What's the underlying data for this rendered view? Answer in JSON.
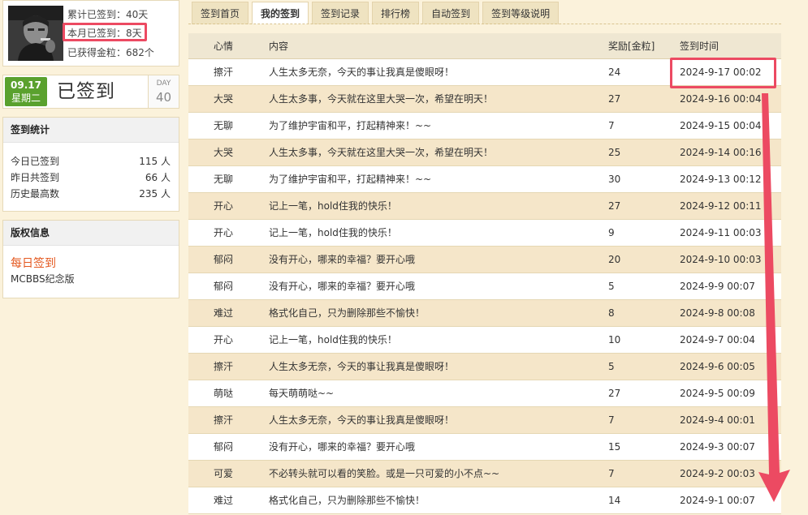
{
  "profile": {
    "total_days": "累计已签到：40天",
    "month_days": "本月已签到：8天",
    "coins": "已获得金粒：682个"
  },
  "checkin": {
    "date": "09.17",
    "weekday": "星期二",
    "status": "已签到",
    "day_word": "DAY",
    "day_num": "40",
    "status_color": "#5aa12e"
  },
  "stats": {
    "title": "签到统计",
    "rows": [
      {
        "label": "今日已签到",
        "value": "115 人"
      },
      {
        "label": "昨日共签到",
        "value": "66 人"
      },
      {
        "label": "历史最高数",
        "value": "235 人"
      }
    ]
  },
  "copyright": {
    "title": "版权信息",
    "brand": "每日签到",
    "sub": "MCBBS纪念版",
    "brand_color": "#e4581f"
  },
  "tabs": [
    {
      "label": "签到首页",
      "active": false
    },
    {
      "label": "我的签到",
      "active": true
    },
    {
      "label": "签到记录",
      "active": false
    },
    {
      "label": "排行榜",
      "active": false
    },
    {
      "label": "自动签到",
      "active": false
    },
    {
      "label": "签到等级说明",
      "active": false
    }
  ],
  "table": {
    "headers": {
      "mood": "心情",
      "content": "内容",
      "reward": "奖励[金粒]",
      "time": "签到时间"
    },
    "rows": [
      {
        "mood": "擦汗",
        "content": "人生太多无奈，今天的事让我真是傻眼呀！",
        "reward": "24",
        "time": "2024-9-17 00:02"
      },
      {
        "mood": "大哭",
        "content": "人生太多事，今天就在这里大哭一次，希望在明天！",
        "reward": "27",
        "time": "2024-9-16 00:04"
      },
      {
        "mood": "无聊",
        "content": "为了维护宇宙和平，打起精神来！~~",
        "reward": "7",
        "time": "2024-9-15 00:04"
      },
      {
        "mood": "大哭",
        "content": "人生太多事，今天就在这里大哭一次，希望在明天！",
        "reward": "25",
        "time": "2024-9-14 00:16"
      },
      {
        "mood": "无聊",
        "content": "为了维护宇宙和平，打起精神来！~~",
        "reward": "30",
        "time": "2024-9-13 00:12"
      },
      {
        "mood": "开心",
        "content": "记上一笔，hold住我的快乐！",
        "reward": "27",
        "time": "2024-9-12 00:11"
      },
      {
        "mood": "开心",
        "content": "记上一笔，hold住我的快乐！",
        "reward": "9",
        "time": "2024-9-11 00:03"
      },
      {
        "mood": "郁闷",
        "content": "没有开心，哪来的幸福？要开心哦",
        "reward": "20",
        "time": "2024-9-10 00:03"
      },
      {
        "mood": "郁闷",
        "content": "没有开心，哪来的幸福？要开心哦",
        "reward": "5",
        "time": "2024-9-9 00:07"
      },
      {
        "mood": "难过",
        "content": "格式化自己，只为删除那些不愉快！",
        "reward": "8",
        "time": "2024-9-8 00:08"
      },
      {
        "mood": "开心",
        "content": "记上一笔，hold住我的快乐！",
        "reward": "10",
        "time": "2024-9-7 00:04"
      },
      {
        "mood": "擦汗",
        "content": "人生太多无奈，今天的事让我真是傻眼呀！",
        "reward": "5",
        "time": "2024-9-6 00:05"
      },
      {
        "mood": "萌哒",
        "content": "每天萌萌哒~~",
        "reward": "27",
        "time": "2024-9-5 00:09"
      },
      {
        "mood": "擦汗",
        "content": "人生太多无奈，今天的事让我真是傻眼呀！",
        "reward": "7",
        "time": "2024-9-4 00:01"
      },
      {
        "mood": "郁闷",
        "content": "没有开心，哪来的幸福？要开心哦",
        "reward": "15",
        "time": "2024-9-3 00:07"
      },
      {
        "mood": "可爱",
        "content": "不必转头就可以看的笑脸。或是一只可爱的小不点~~",
        "reward": "7",
        "time": "2024-9-2 00:03"
      },
      {
        "mood": "难过",
        "content": "格式化自己，只为删除那些不愉快！",
        "reward": "14",
        "time": "2024-9-1 00:07"
      }
    ]
  },
  "annotation_color": "#ec4a62"
}
